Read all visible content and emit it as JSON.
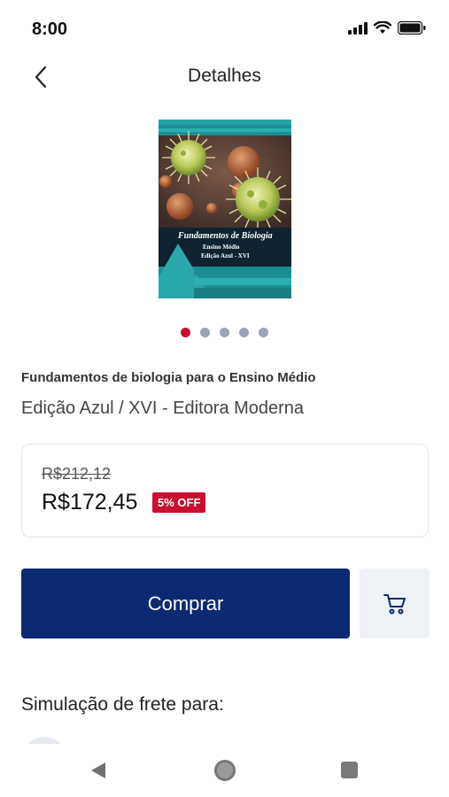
{
  "status_bar": {
    "time": "8:00",
    "icons": [
      "signal-icon",
      "wifi-icon",
      "battery-icon"
    ]
  },
  "header": {
    "back_icon": "chevron-left-icon",
    "title": "Detalhes"
  },
  "product": {
    "cover": {
      "title": "Fundamentos de Biologia",
      "line2": "Ensino Médio",
      "line3": "Edição Azul - XVI"
    },
    "carousel": {
      "count": 5,
      "active_index": 0
    },
    "title": "Fundamentos de biologia para o Ensino Médio",
    "subtitle": "Edição Azul / XVI - Editora Moderna"
  },
  "price": {
    "old": "R$212,12",
    "current": "R$172,45",
    "discount": "5% OFF"
  },
  "actions": {
    "buy_label": "Comprar",
    "cart_icon": "cart-icon"
  },
  "shipping": {
    "heading": "Simulação de frete para:"
  },
  "nav_bar": {
    "icons": [
      "nav-back-icon",
      "nav-home-icon",
      "nav-recent-icon"
    ]
  },
  "colors": {
    "primary": "#0b2a72",
    "accent_red": "#c8102e",
    "dot_inactive": "#9aa3b8",
    "cart_bg": "#eef1f6"
  }
}
